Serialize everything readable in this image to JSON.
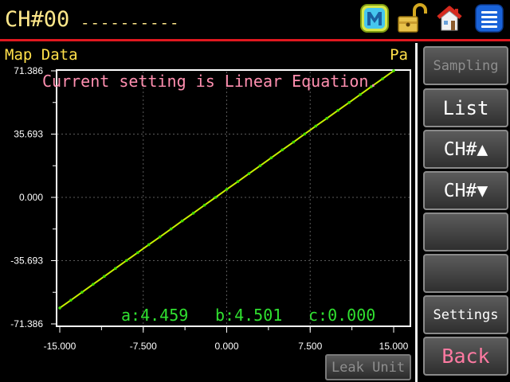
{
  "header": {
    "channel_title": "CH#00",
    "channel_name": "----------",
    "accent_color": "#e0181f",
    "icons": [
      "m-icon",
      "lock-open-icon",
      "home-icon",
      "menu-list-icon"
    ]
  },
  "plot": {
    "title": "Map Data",
    "unit": "Pa",
    "message": "Current setting is Linear Equation.",
    "coefficients": {
      "a": "a:4.459",
      "b": "b:4.501",
      "c": "c:0.000"
    }
  },
  "chart_data": {
    "type": "line",
    "xlim": [
      -15.0,
      15.0
    ],
    "ylim": [
      -71.386,
      71.386
    ],
    "x_ticks": [
      "-15.000",
      "-7.500",
      "0.000",
      "7.500",
      "15.000"
    ],
    "y_ticks": [
      "71.386",
      "35.693",
      "0.000",
      "-35.693",
      "-71.386"
    ],
    "grid": true,
    "line_color": "#c8f000",
    "marker_color": "#44e000",
    "series": [
      {
        "x": [
          -15.0,
          -14.0,
          -13.0,
          -12.0,
          -11.0,
          -10.0,
          -9.0,
          -8.0,
          -7.0,
          -6.0,
          -5.0,
          -4.0,
          -3.0,
          -2.0,
          -1.0,
          0.0,
          1.0,
          2.0,
          3.0,
          4.0,
          5.0,
          6.0,
          7.0,
          8.0,
          9.0,
          10.0,
          11.0,
          12.0,
          13.0,
          14.0,
          15.0
        ],
        "y": [
          -62.4,
          -58.0,
          -53.5,
          -49.0,
          -44.6,
          -40.1,
          -35.6,
          -31.2,
          -26.7,
          -22.3,
          -17.8,
          -13.3,
          -8.9,
          -4.4,
          0.0,
          4.5,
          8.9,
          13.4,
          17.8,
          22.3,
          26.8,
          31.2,
          35.7,
          40.2,
          44.6,
          49.1,
          53.5,
          58.0,
          62.5,
          66.9,
          71.4
        ]
      }
    ]
  },
  "side_buttons": {
    "sampling": "Sampling",
    "list": "List",
    "ch_up": "CH#▲",
    "ch_down": "CH#▼",
    "blank_1": "",
    "blank_2": "",
    "settings": "Settings",
    "back": "Back"
  },
  "leak_unit": "Leak Unit"
}
